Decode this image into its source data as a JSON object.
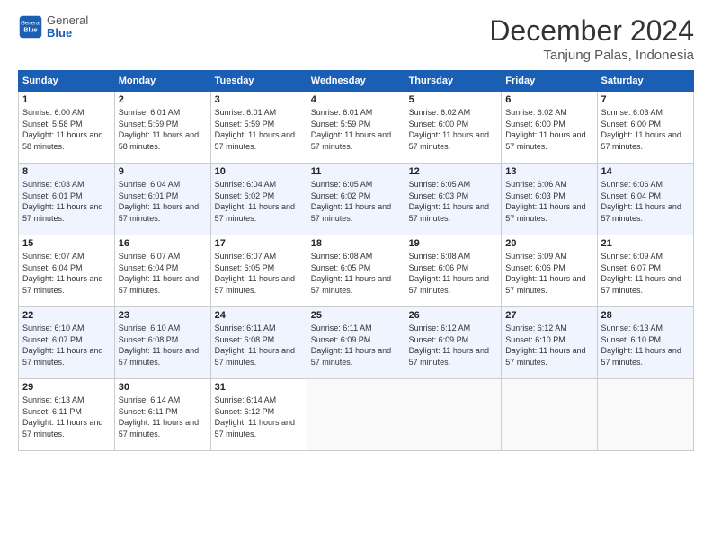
{
  "logo": {
    "general": "General",
    "blue": "Blue"
  },
  "header": {
    "month_year": "December 2024",
    "location": "Tanjung Palas, Indonesia"
  },
  "weekdays": [
    "Sunday",
    "Monday",
    "Tuesday",
    "Wednesday",
    "Thursday",
    "Friday",
    "Saturday"
  ],
  "weeks": [
    [
      {
        "day": "1",
        "sunrise": "6:00 AM",
        "sunset": "5:58 PM",
        "daylight": "11 hours and 58 minutes."
      },
      {
        "day": "2",
        "sunrise": "6:01 AM",
        "sunset": "5:59 PM",
        "daylight": "11 hours and 58 minutes."
      },
      {
        "day": "3",
        "sunrise": "6:01 AM",
        "sunset": "5:59 PM",
        "daylight": "11 hours and 57 minutes."
      },
      {
        "day": "4",
        "sunrise": "6:01 AM",
        "sunset": "5:59 PM",
        "daylight": "11 hours and 57 minutes."
      },
      {
        "day": "5",
        "sunrise": "6:02 AM",
        "sunset": "6:00 PM",
        "daylight": "11 hours and 57 minutes."
      },
      {
        "day": "6",
        "sunrise": "6:02 AM",
        "sunset": "6:00 PM",
        "daylight": "11 hours and 57 minutes."
      },
      {
        "day": "7",
        "sunrise": "6:03 AM",
        "sunset": "6:00 PM",
        "daylight": "11 hours and 57 minutes."
      }
    ],
    [
      {
        "day": "8",
        "sunrise": "6:03 AM",
        "sunset": "6:01 PM",
        "daylight": "11 hours and 57 minutes."
      },
      {
        "day": "9",
        "sunrise": "6:04 AM",
        "sunset": "6:01 PM",
        "daylight": "11 hours and 57 minutes."
      },
      {
        "day": "10",
        "sunrise": "6:04 AM",
        "sunset": "6:02 PM",
        "daylight": "11 hours and 57 minutes."
      },
      {
        "day": "11",
        "sunrise": "6:05 AM",
        "sunset": "6:02 PM",
        "daylight": "11 hours and 57 minutes."
      },
      {
        "day": "12",
        "sunrise": "6:05 AM",
        "sunset": "6:03 PM",
        "daylight": "11 hours and 57 minutes."
      },
      {
        "day": "13",
        "sunrise": "6:06 AM",
        "sunset": "6:03 PM",
        "daylight": "11 hours and 57 minutes."
      },
      {
        "day": "14",
        "sunrise": "6:06 AM",
        "sunset": "6:04 PM",
        "daylight": "11 hours and 57 minutes."
      }
    ],
    [
      {
        "day": "15",
        "sunrise": "6:07 AM",
        "sunset": "6:04 PM",
        "daylight": "11 hours and 57 minutes."
      },
      {
        "day": "16",
        "sunrise": "6:07 AM",
        "sunset": "6:04 PM",
        "daylight": "11 hours and 57 minutes."
      },
      {
        "day": "17",
        "sunrise": "6:07 AM",
        "sunset": "6:05 PM",
        "daylight": "11 hours and 57 minutes."
      },
      {
        "day": "18",
        "sunrise": "6:08 AM",
        "sunset": "6:05 PM",
        "daylight": "11 hours and 57 minutes."
      },
      {
        "day": "19",
        "sunrise": "6:08 AM",
        "sunset": "6:06 PM",
        "daylight": "11 hours and 57 minutes."
      },
      {
        "day": "20",
        "sunrise": "6:09 AM",
        "sunset": "6:06 PM",
        "daylight": "11 hours and 57 minutes."
      },
      {
        "day": "21",
        "sunrise": "6:09 AM",
        "sunset": "6:07 PM",
        "daylight": "11 hours and 57 minutes."
      }
    ],
    [
      {
        "day": "22",
        "sunrise": "6:10 AM",
        "sunset": "6:07 PM",
        "daylight": "11 hours and 57 minutes."
      },
      {
        "day": "23",
        "sunrise": "6:10 AM",
        "sunset": "6:08 PM",
        "daylight": "11 hours and 57 minutes."
      },
      {
        "day": "24",
        "sunrise": "6:11 AM",
        "sunset": "6:08 PM",
        "daylight": "11 hours and 57 minutes."
      },
      {
        "day": "25",
        "sunrise": "6:11 AM",
        "sunset": "6:09 PM",
        "daylight": "11 hours and 57 minutes."
      },
      {
        "day": "26",
        "sunrise": "6:12 AM",
        "sunset": "6:09 PM",
        "daylight": "11 hours and 57 minutes."
      },
      {
        "day": "27",
        "sunrise": "6:12 AM",
        "sunset": "6:10 PM",
        "daylight": "11 hours and 57 minutes."
      },
      {
        "day": "28",
        "sunrise": "6:13 AM",
        "sunset": "6:10 PM",
        "daylight": "11 hours and 57 minutes."
      }
    ],
    [
      {
        "day": "29",
        "sunrise": "6:13 AM",
        "sunset": "6:11 PM",
        "daylight": "11 hours and 57 minutes."
      },
      {
        "day": "30",
        "sunrise": "6:14 AM",
        "sunset": "6:11 PM",
        "daylight": "11 hours and 57 minutes."
      },
      {
        "day": "31",
        "sunrise": "6:14 AM",
        "sunset": "6:12 PM",
        "daylight": "11 hours and 57 minutes."
      },
      null,
      null,
      null,
      null
    ]
  ]
}
